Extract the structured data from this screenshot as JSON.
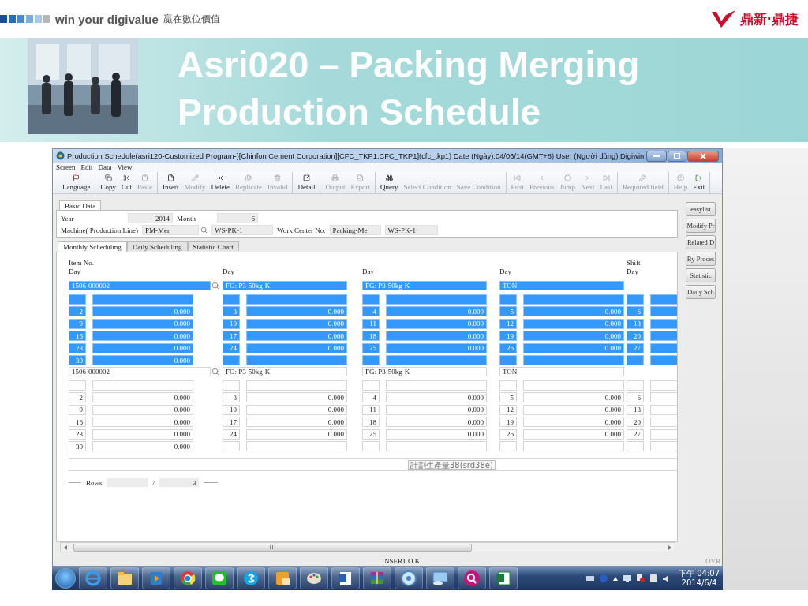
{
  "slide": {
    "brand": "win your digivalue",
    "tagline": "贏在數位價值",
    "company": "鼎新·鼎捷",
    "title_lines": [
      "Asri020 – Packing Merging",
      "Production Schedule"
    ]
  },
  "window": {
    "title": "Production Schedule(asri120-Customized Program-)[Chinfon Cement Corporation][CFC_TKP1:CFC_TKP1](cfc_tkp1)  Date (Ngày):04/06/14(GMT+8)  User (Người dùng):Digiwin"
  },
  "menu": [
    "Screen",
    "Edit",
    "Data",
    "View"
  ],
  "toolbar_groups": [
    {
      "items": [
        {
          "label": "Language",
          "disabled": false
        }
      ]
    },
    {
      "items": [
        {
          "label": "Copy",
          "disabled": false
        },
        {
          "label": "Cut",
          "disabled": false
        },
        {
          "label": "Paste",
          "disabled": true
        }
      ]
    },
    {
      "items": [
        {
          "label": "Insert",
          "disabled": false
        },
        {
          "label": "Modify",
          "disabled": true
        },
        {
          "label": "Delete",
          "disabled": false
        },
        {
          "label": "Replicate",
          "disabled": true
        },
        {
          "label": "Invalid",
          "disabled": true
        }
      ]
    },
    {
      "items": [
        {
          "label": "Detail",
          "disabled": false
        }
      ]
    },
    {
      "items": [
        {
          "label": "Output",
          "disabled": true
        },
        {
          "label": "Export",
          "disabled": true
        }
      ]
    },
    {
      "items": [
        {
          "label": "Query",
          "disabled": false
        },
        {
          "label": "Select Condition",
          "disabled": true
        },
        {
          "label": "Save Condition",
          "disabled": true
        }
      ]
    },
    {
      "items": [
        {
          "label": "First",
          "disabled": true
        },
        {
          "label": "Previous",
          "disabled": true
        },
        {
          "label": "Jump",
          "disabled": true
        },
        {
          "label": "Next",
          "disabled": true
        },
        {
          "label": "Last",
          "disabled": true
        }
      ]
    },
    {
      "items": [
        {
          "label": "Required field",
          "disabled": true
        }
      ]
    },
    {
      "items": [
        {
          "label": "Help",
          "disabled": true
        },
        {
          "label": "Exit",
          "disabled": false
        }
      ]
    }
  ],
  "basic_data": {
    "tab": "Basic Data",
    "rows": [
      [
        {
          "kind": "label",
          "text": "Year"
        },
        {
          "kind": "number",
          "value": "2014"
        },
        {
          "kind": "label",
          "text": "Month"
        },
        {
          "kind": "number",
          "value": "6"
        }
      ],
      [
        {
          "kind": "label",
          "text": "Machine( Production Line)"
        },
        {
          "kind": "lookup",
          "value": "PM-Mer"
        },
        {
          "kind": "text",
          "value": "WS-PK-1"
        },
        {
          "kind": "label",
          "text": "Work Center No."
        },
        {
          "kind": "text",
          "value": "Packing-Me"
        },
        {
          "kind": "text",
          "value": "WS-PK-1"
        }
      ]
    ]
  },
  "side_buttons": [
    "easylist",
    "Modify Pr",
    "Related D",
    "By Proces",
    "Statistic",
    "Daily Sch"
  ],
  "subtabs": [
    {
      "label": "Monthly Scheduling",
      "selected": true
    },
    {
      "label": "Daily Scheduling",
      "selected": false
    },
    {
      "label": "Statistic Chart",
      "selected": false
    }
  ],
  "grid": {
    "headers": [
      {
        "lines": [
          "Item No.",
          "Day"
        ]
      },
      {
        "lines": [
          "Day"
        ]
      },
      {
        "lines": [
          "Day"
        ]
      },
      {
        "lines": [
          "Day"
        ]
      },
      {
        "lines": [
          "Shift",
          "Day"
        ]
      }
    ],
    "blocks": [
      {
        "selected": true,
        "groups": [
          {
            "kind": "lookup",
            "item": "1506-000002",
            "rows": [
              {},
              {
                "day": "2",
                "value": "0.000"
              },
              {
                "day": "9",
                "value": "0.000"
              },
              {
                "day": "16",
                "value": "0.000"
              },
              {
                "day": "23",
                "value": "0.000"
              },
              {
                "day": "30",
                "value": "0.000"
              }
            ]
          },
          {
            "kind": "text",
            "item": "FG: P3-50kg-K",
            "rows": [
              {},
              {
                "day": "3",
                "value": "0.000"
              },
              {
                "day": "10",
                "value": "0.000"
              },
              {
                "day": "17",
                "value": "0.000"
              },
              {
                "day": "24",
                "value": "0.000"
              },
              {}
            ]
          },
          {
            "kind": "text",
            "item": "FG: P3-50kg-K",
            "rows": [
              {},
              {
                "day": "4",
                "value": "0.000"
              },
              {
                "day": "11",
                "value": "0.000"
              },
              {
                "day": "18",
                "value": "0.000"
              },
              {
                "day": "25",
                "value": "0.000"
              },
              {}
            ]
          },
          {
            "kind": "text",
            "item": "TON",
            "rows": [
              {},
              {
                "day": "5",
                "value": "0.000"
              },
              {
                "day": "12",
                "value": "0.000"
              },
              {
                "day": "19",
                "value": "0.000"
              },
              {
                "day": "26",
                "value": "0.000"
              },
              {}
            ]
          },
          {
            "kind": "blank",
            "rows": [
              {},
              {
                "day": "6"
              },
              {
                "day": "13"
              },
              {
                "day": "20"
              },
              {
                "day": "27"
              },
              {}
            ]
          }
        ]
      },
      {
        "selected": false,
        "groups": [
          {
            "kind": "lookup",
            "item": "1506-000002",
            "rows": [
              {},
              {
                "day": "2",
                "value": "0.000"
              },
              {
                "day": "9",
                "value": "0.000"
              },
              {
                "day": "16",
                "value": "0.000"
              },
              {
                "day": "23",
                "value": "0.000"
              },
              {
                "day": "30",
                "value": "0.000"
              }
            ]
          },
          {
            "kind": "text",
            "item": "FG: P3-50kg-K",
            "rows": [
              {},
              {
                "day": "3",
                "value": "0.000"
              },
              {
                "day": "10",
                "value": "0.000"
              },
              {
                "day": "17",
                "value": "0.000"
              },
              {
                "day": "24",
                "value": "0.000"
              },
              {}
            ]
          },
          {
            "kind": "text",
            "item": "FG: P3-50kg-K",
            "rows": [
              {},
              {
                "day": "4",
                "value": "0.000"
              },
              {
                "day": "11",
                "value": "0.000"
              },
              {
                "day": "18",
                "value": "0.000"
              },
              {
                "day": "25",
                "value": "0.000"
              },
              {}
            ]
          },
          {
            "kind": "text",
            "item": "TON",
            "rows": [
              {},
              {
                "day": "5",
                "value": "0.000"
              },
              {
                "day": "12",
                "value": "0.000"
              },
              {
                "day": "19",
                "value": "0.000"
              },
              {
                "day": "26",
                "value": "0.000"
              },
              {}
            ]
          },
          {
            "kind": "blank",
            "rows": [
              {},
              {
                "day": "6"
              },
              {
                "day": "13"
              },
              {
                "day": "20"
              },
              {
                "day": "27"
              },
              {}
            ]
          }
        ]
      }
    ]
  },
  "tooltip": "計劃生產量38(srd38e)",
  "rows_bar": {
    "label": "Rows",
    "separator": "/",
    "total": "3"
  },
  "status_bar": {
    "message": "INSERT O.K",
    "mode": "OVR"
  },
  "clock": {
    "time": "下午 04:07",
    "date": "2014/6/4"
  }
}
